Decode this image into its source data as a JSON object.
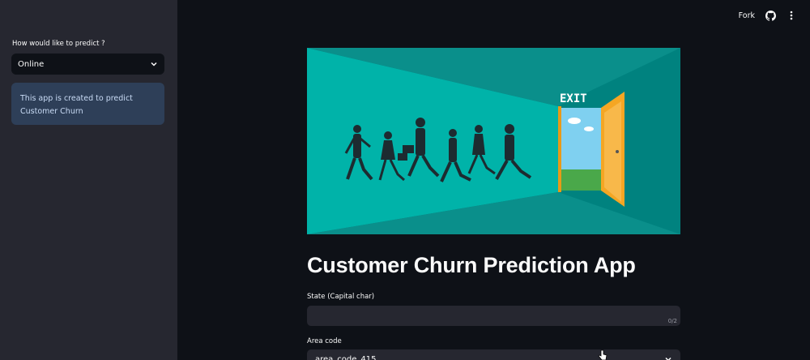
{
  "sidebar": {
    "prompt_label": "How would like to predict ?",
    "selected": "Online",
    "info_text": "This app is created to predict Customer Churn"
  },
  "header": {
    "fork_label": "Fork"
  },
  "hero": {
    "sign_text": "EXIT"
  },
  "main": {
    "title": "Customer Churn Prediction App",
    "state_label": "State (Capital char)",
    "state_counter": "0/2",
    "area_label": "Area code",
    "area_value": "area_code_415"
  },
  "colors": {
    "sidebar_bg": "#262730",
    "main_bg": "#0e1117",
    "info_bg": "#2e3f58",
    "hero_bg": "#00827f",
    "hero_floor": "#00b3a9",
    "door": "#f5a623"
  }
}
